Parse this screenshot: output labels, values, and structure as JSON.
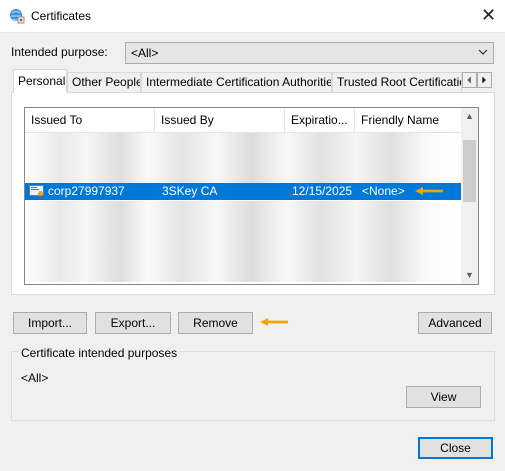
{
  "window": {
    "title": "Certificates",
    "close_glyph": "✕"
  },
  "purpose": {
    "label": "Intended purpose:",
    "value": "<All>"
  },
  "tabs": [
    {
      "label": "Personal"
    },
    {
      "label": "Other People"
    },
    {
      "label": "Intermediate Certification Authorities"
    },
    {
      "label": "Trusted Root Certification"
    }
  ],
  "list": {
    "columns": [
      "Issued To",
      "Issued By",
      "Expiratio...",
      "Friendly Name"
    ],
    "selected_row": {
      "issued_to": "corp27997937",
      "issued_by": "3SKey CA",
      "expiration": "12/15/2025",
      "friendly_name": "<None>"
    }
  },
  "buttons": {
    "import": "Import...",
    "export": "Export...",
    "remove": "Remove",
    "advanced": "Advanced",
    "view": "View",
    "close": "Close"
  },
  "purposes_group": {
    "title": "Certificate intended purposes",
    "value": "<All>"
  },
  "colors": {
    "selection": "#0078d7",
    "annotation_arrow": "#f0a30a"
  },
  "icons": [
    "certificates-app-icon",
    "certificate-icon",
    "chevron-down-icon",
    "arrow-left-icon"
  ]
}
